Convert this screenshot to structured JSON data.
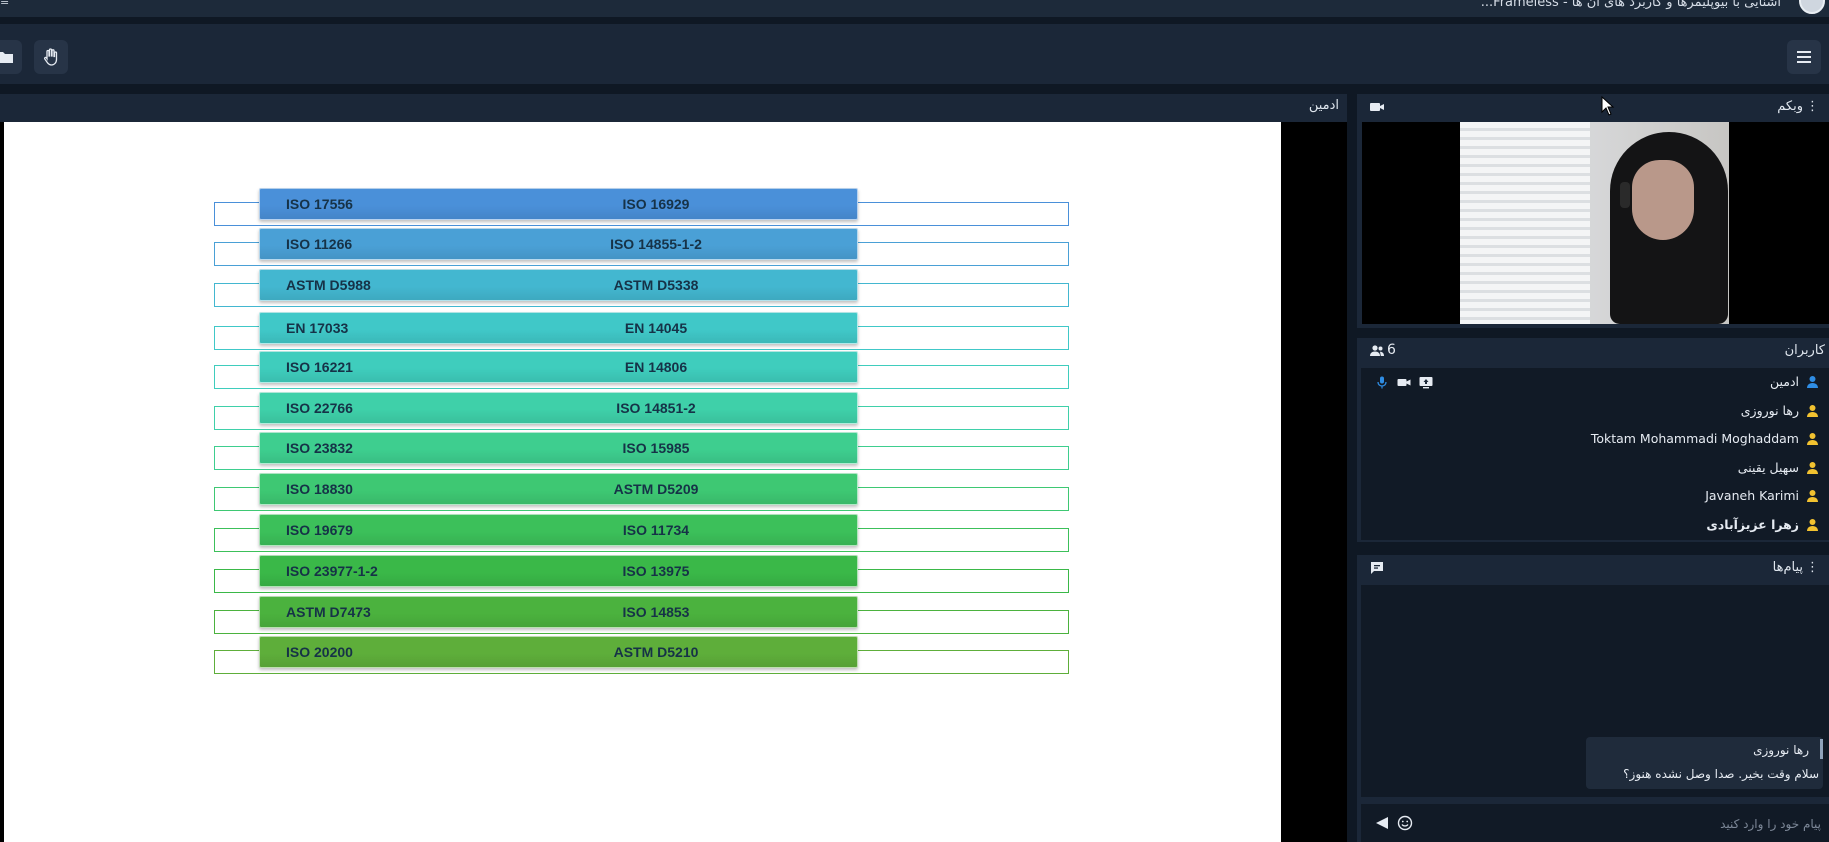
{
  "window": {
    "title": "آشنایی با بیوپلیمرها و کاربرد های آن ها - Frameless..."
  },
  "toolbar": {
    "menu_icon": "hamburger-icon",
    "hand_icon": "raise-hand-icon"
  },
  "presentation": {
    "presenter": "ادمین",
    "slide_rows": [
      {
        "left": "ISO 17556",
        "right": "ISO 16929",
        "color": "#4a90d9"
      },
      {
        "left": "ISO 11266",
        "right": "ISO 14855-1-2",
        "color": "#4aa0d6"
      },
      {
        "left": "ASTM D5988",
        "right": "ASTM D5338",
        "color": "#43b7d0"
      },
      {
        "left": "EN 17033",
        "right": "EN 14045",
        "color": "#40c8c8"
      },
      {
        "left": "ISO 16221",
        "right": "EN 14806",
        "color": "#3fcdbd"
      },
      {
        "left": "ISO 22766",
        "right": "ISO 14851-2",
        "color": "#3fd0a9"
      },
      {
        "left": "ISO 23832",
        "right": "ISO 15985",
        "color": "#3ece8f"
      },
      {
        "left": "ISO 18830",
        "right": "ASTM D5209",
        "color": "#3ec873"
      },
      {
        "left": "ISO 19679",
        "right": "ISO 11734",
        "color": "#3cc05a"
      },
      {
        "left": "ISO 23977-1-2",
        "right": "ISO 13975",
        "color": "#3ab848"
      },
      {
        "left": "ASTM D7473",
        "right": "ISO 14853",
        "color": "#4bb23e"
      },
      {
        "left": "ISO 20200",
        "right": "ASTM D5210",
        "color": "#5eae3a"
      }
    ]
  },
  "webcam": {
    "title": "وبکم"
  },
  "users": {
    "title": "کاربران",
    "count": "6",
    "list": [
      {
        "name": "ادمین",
        "color": "#2f8de4",
        "bold": false,
        "media": true
      },
      {
        "name": "رها نوروزی",
        "color": "#f2c230",
        "bold": false,
        "media": false
      },
      {
        "name": "Toktam Mohammadi Moghaddam",
        "color": "#f2c230",
        "bold": false,
        "media": false
      },
      {
        "name": "سهیل یقینی",
        "color": "#f2c230",
        "bold": false,
        "media": false
      },
      {
        "name": "Javaneh Karimi",
        "color": "#f2c230",
        "bold": false,
        "media": false
      },
      {
        "name": "زهرا عزیزآبادی",
        "color": "#f2c230",
        "bold": true,
        "media": false
      }
    ]
  },
  "chat": {
    "title": "پیام‌ها",
    "message": {
      "sender": "رها نوروزی",
      "text": "سلام وقت بخیر. صدا وصل نشده هنوز؟"
    },
    "input_placeholder": "پیام خود را وارد کنید"
  },
  "colors": {
    "background": "#0f1824",
    "panel": "#1b2738",
    "accent_blue": "#2f8de4",
    "user_yellow": "#f2c230"
  }
}
